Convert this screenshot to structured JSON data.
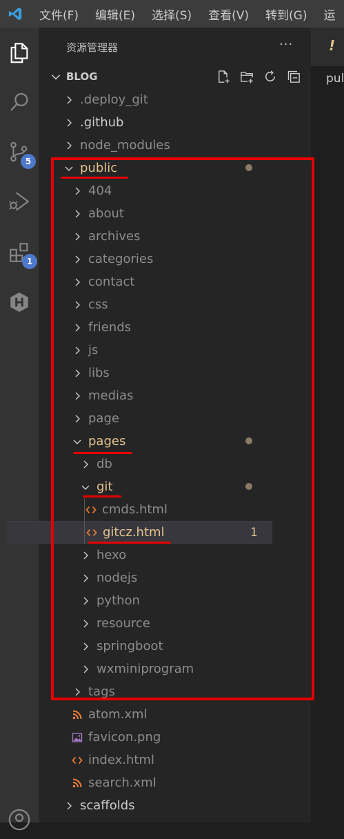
{
  "menubar": {
    "logo_icon": "vscode-logo-icon",
    "items": [
      "文件(F)",
      "编辑(E)",
      "选择(S)",
      "查看(V)",
      "转到(G)",
      "运"
    ]
  },
  "activitybar": {
    "items": [
      {
        "name": "explorer-icon"
      },
      {
        "name": "search-icon"
      },
      {
        "name": "source-control-icon",
        "badge": "5"
      },
      {
        "name": "run-debug-icon"
      },
      {
        "name": "extensions-icon",
        "badge": "1"
      },
      {
        "name": "hexo-icon"
      },
      {
        "name": "account-icon"
      }
    ]
  },
  "sidebar": {
    "title": "资源管理器",
    "more": "···",
    "section": "BLOG",
    "actions": [
      "new-file-icon",
      "new-folder-icon",
      "refresh-icon",
      "collapse-all-icon"
    ]
  },
  "tree": [
    {
      "label": ".deploy_git",
      "kind": "folder",
      "level": 0,
      "expanded": false,
      "muted": true
    },
    {
      "label": ".github",
      "kind": "folder",
      "level": 0,
      "expanded": false
    },
    {
      "label": "node_modules",
      "kind": "folder",
      "level": 0,
      "expanded": false,
      "muted": true
    },
    {
      "label": "public",
      "kind": "folder",
      "level": 0,
      "expanded": true,
      "modified": true
    },
    {
      "label": "404",
      "kind": "folder",
      "level": 1,
      "expanded": false,
      "muted": true
    },
    {
      "label": "about",
      "kind": "folder",
      "level": 1,
      "expanded": false,
      "muted": true
    },
    {
      "label": "archives",
      "kind": "folder",
      "level": 1,
      "expanded": false,
      "muted": true
    },
    {
      "label": "categories",
      "kind": "folder",
      "level": 1,
      "expanded": false,
      "muted": true
    },
    {
      "label": "contact",
      "kind": "folder",
      "level": 1,
      "expanded": false,
      "muted": true
    },
    {
      "label": "css",
      "kind": "folder",
      "level": 1,
      "expanded": false,
      "muted": true
    },
    {
      "label": "friends",
      "kind": "folder",
      "level": 1,
      "expanded": false,
      "muted": true
    },
    {
      "label": "js",
      "kind": "folder",
      "level": 1,
      "expanded": false,
      "muted": true
    },
    {
      "label": "libs",
      "kind": "folder",
      "level": 1,
      "expanded": false,
      "muted": true
    },
    {
      "label": "medias",
      "kind": "folder",
      "level": 1,
      "expanded": false,
      "muted": true
    },
    {
      "label": "page",
      "kind": "folder",
      "level": 1,
      "expanded": false,
      "muted": true
    },
    {
      "label": "pages",
      "kind": "folder",
      "level": 1,
      "expanded": true,
      "modified": true
    },
    {
      "label": "db",
      "kind": "folder",
      "level": 2,
      "expanded": false,
      "muted": true
    },
    {
      "label": "git",
      "kind": "folder",
      "level": 2,
      "expanded": true,
      "modified": true
    },
    {
      "label": "cmds.html",
      "kind": "html",
      "level": 3,
      "muted": true
    },
    {
      "label": "gitcz.html",
      "kind": "html",
      "level": 3,
      "modified": true,
      "selected": true,
      "count": "1"
    },
    {
      "label": "hexo",
      "kind": "folder",
      "level": 2,
      "expanded": false,
      "muted": true
    },
    {
      "label": "nodejs",
      "kind": "folder",
      "level": 2,
      "expanded": false,
      "muted": true
    },
    {
      "label": "python",
      "kind": "folder",
      "level": 2,
      "expanded": false,
      "muted": true
    },
    {
      "label": "resource",
      "kind": "folder",
      "level": 2,
      "expanded": false,
      "muted": true
    },
    {
      "label": "springboot",
      "kind": "folder",
      "level": 2,
      "expanded": false,
      "muted": true
    },
    {
      "label": "wxminiprogram",
      "kind": "folder",
      "level": 2,
      "expanded": false,
      "muted": true
    },
    {
      "label": "tags",
      "kind": "folder",
      "level": 1,
      "expanded": false,
      "muted": true
    },
    {
      "label": "atom.xml",
      "kind": "rss",
      "level": 1,
      "muted": true
    },
    {
      "label": "favicon.png",
      "kind": "image",
      "level": 1,
      "muted": true
    },
    {
      "label": "index.html",
      "kind": "html",
      "level": 1,
      "muted": true
    },
    {
      "label": "search.xml",
      "kind": "rss",
      "level": 1,
      "muted": true
    },
    {
      "label": "scaffolds",
      "kind": "folder",
      "level": 0,
      "expanded": false
    }
  ],
  "editor": {
    "tab_marker": "!",
    "text": "pul"
  },
  "colors": {
    "modified": "#e2c08d",
    "muted": "#8c8c8c",
    "normal": "#cccccc",
    "annotation": "#e50000",
    "html_icon": "#e37933",
    "rss_icon": "#f0803c",
    "image_icon": "#a074c4"
  }
}
